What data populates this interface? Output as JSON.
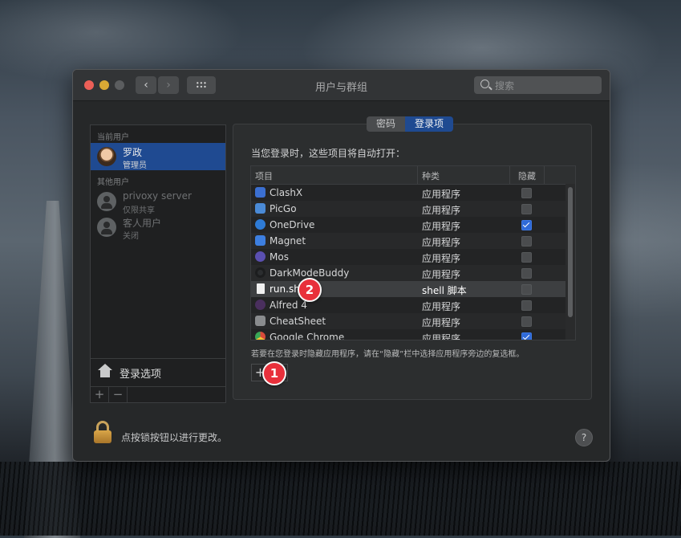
{
  "window": {
    "title": "用户与群组"
  },
  "search": {
    "placeholder": "搜索"
  },
  "sidebar": {
    "current_section": "当前用户",
    "other_section": "其他用户",
    "users": [
      {
        "name": "罗政",
        "role": "管理员",
        "selected": true
      },
      {
        "name": "privoxy server",
        "role": "仅限共享",
        "selected": false
      },
      {
        "name": "客人用户",
        "role": "关闭",
        "selected": false
      }
    ],
    "login_options": "登录选项",
    "add": "+",
    "remove": "−"
  },
  "tabs": [
    {
      "label": "密码",
      "active": false
    },
    {
      "label": "登录项",
      "active": true
    }
  ],
  "login_items": {
    "intro": "当您登录时，这些项目将自动打开：",
    "columns": [
      "项目",
      "种类",
      "隐藏"
    ],
    "rows": [
      {
        "name": "ClashX",
        "kind": "应用程序",
        "hidden": false,
        "icon": "clashx-icon",
        "color": "#3b6fd1"
      },
      {
        "name": "PicGo",
        "kind": "应用程序",
        "hidden": false,
        "icon": "picgo-icon",
        "color": "#4a8ad6"
      },
      {
        "name": "OneDrive",
        "kind": "应用程序",
        "hidden": true,
        "icon": "onedrive-icon",
        "color": "#2e7bd6"
      },
      {
        "name": "Magnet",
        "kind": "应用程序",
        "hidden": false,
        "icon": "magnet-icon",
        "color": "#3d7fe0"
      },
      {
        "name": "Mos",
        "kind": "应用程序",
        "hidden": false,
        "icon": "mos-icon",
        "color": "#5a4fb0"
      },
      {
        "name": "DarkModeBuddy",
        "kind": "应用程序",
        "hidden": false,
        "icon": "darkmodebuddy-icon",
        "color": "#2b2d2f"
      },
      {
        "name": "run.sh",
        "kind": "shell 脚本",
        "hidden": false,
        "icon": "document-icon",
        "color": "#f0f0f0"
      },
      {
        "name": "Alfred 4",
        "kind": "应用程序",
        "hidden": false,
        "icon": "alfred-icon",
        "color": "#4a2f5e"
      },
      {
        "name": "CheatSheet",
        "kind": "应用程序",
        "hidden": false,
        "icon": "cheatsheet-icon",
        "color": "#8a8c8e"
      },
      {
        "name": "Google Chrome",
        "kind": "应用程序",
        "hidden": true,
        "icon": "chrome-icon",
        "color": "#e0a23a"
      }
    ],
    "hint": "若要在您登录时隐藏应用程序，请在“隐藏”栏中选择应用程序旁边的复选框。",
    "add": "+",
    "remove": "−"
  },
  "badges": {
    "one": "1",
    "two": "2"
  },
  "footer": {
    "lock_text": "点按锁按钮以进行更改。",
    "help": "?"
  }
}
